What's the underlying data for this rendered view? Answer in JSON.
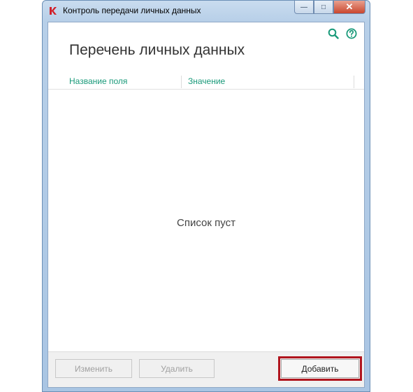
{
  "window": {
    "title": "Контроль передачи личных данных",
    "caption": {
      "minimize": "—",
      "maximize": "□",
      "close": "✕"
    }
  },
  "page": {
    "heading": "Перечень личных данных",
    "columns": [
      "Название поля",
      "Значение"
    ],
    "empty_message": "Список пуст"
  },
  "buttons": {
    "edit": "Изменить",
    "delete": "Удалить",
    "add": "Добавить"
  },
  "icons": {
    "search": "search-icon",
    "help": "help-icon"
  },
  "colors": {
    "accent": "#1a9a7a",
    "highlight": "#b0151e"
  }
}
